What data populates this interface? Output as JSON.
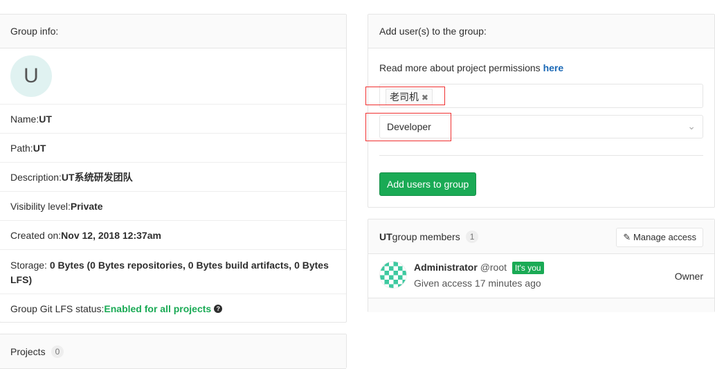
{
  "group_info": {
    "title": "Group info:",
    "avatar_letter": "U",
    "rows": [
      {
        "label": "Name: ",
        "value": "UT"
      },
      {
        "label": "Path: ",
        "value": "UT"
      },
      {
        "label": "Description: ",
        "value": "UT系统研发团队"
      },
      {
        "label": "Visibility level: ",
        "value": "Private"
      },
      {
        "label": "Created on: ",
        "value": "Nov 12, 2018 12:37am"
      },
      {
        "label": "Storage: ",
        "value": "0 Bytes (0 Bytes repositories, 0 Bytes build artifacts, 0 Bytes LFS)"
      }
    ],
    "lfs_label": "Group Git LFS status: ",
    "lfs_value": "Enabled for all projects"
  },
  "projects": {
    "title": "Projects",
    "count": "0"
  },
  "add_users": {
    "title": "Add user(s) to the group:",
    "permissions_text": "Read more about project permissions ",
    "permissions_link": "here",
    "selected_user": "老司机",
    "role": "Developer",
    "submit": "Add users to group"
  },
  "members": {
    "group": "UT",
    "title": " group members",
    "count": "1",
    "manage": "Manage access",
    "list": [
      {
        "name": "Administrator",
        "username": "@root",
        "badge": "It's you",
        "access": "Given access 17 minutes ago",
        "role": "Owner"
      }
    ]
  }
}
